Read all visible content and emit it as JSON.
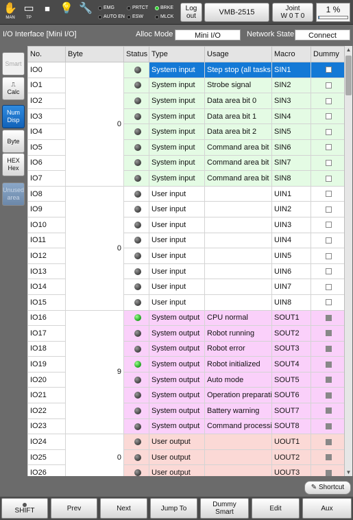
{
  "topbar": {
    "icons": [
      {
        "name": "man-icon",
        "label": "MAN",
        "glyph": "✋"
      },
      {
        "name": "tp-icon",
        "label": "TP",
        "glyph": "▭"
      },
      {
        "name": "stop-icon",
        "label": "",
        "glyph": "■"
      },
      {
        "name": "lightbulb-icon",
        "label": "",
        "glyph": "💡"
      },
      {
        "name": "wrench-icon",
        "label": "",
        "glyph": "🔧"
      }
    ],
    "lamps": {
      "emg": {
        "label": "EMG",
        "on": false
      },
      "auto_en": {
        "label": "AUTO EN",
        "on": false
      },
      "prtct": {
        "label": "PRTCT",
        "on": false
      },
      "esw": {
        "label": "ESW",
        "on": false
      },
      "brke": {
        "label": "BRKE",
        "on": true
      },
      "mlck": {
        "label": "MLCK",
        "on": false
      }
    },
    "logout": {
      "line1": "Log",
      "line2": "out"
    },
    "robot_label": "VMB-2515",
    "coord": {
      "line1": "Joint",
      "line2": "W 0 T 0"
    },
    "speed_text": "1 %",
    "speed_fraction": 0.01
  },
  "title": {
    "text": "I/O Interface [Mini I/O]",
    "alloc_label": "Alloc Mode",
    "alloc_value": "Mini I/O",
    "network_label": "Network State",
    "network_value": "Connect"
  },
  "side_buttons": [
    {
      "name": "smart-button",
      "l1": "Smart",
      "l2": "",
      "state": "disabled"
    },
    {
      "name": "calc-button",
      "l1": "⎍",
      "l2": "Calc",
      "state": "normal"
    },
    {
      "name": "num-disp-button",
      "l1": "Num",
      "l2": "Disp",
      "state": "active"
    },
    {
      "name": "byte-button",
      "l1": "Byte",
      "l2": "",
      "state": "normal"
    },
    {
      "name": "hex-button",
      "l1": "HEX",
      "l2": "Hex",
      "state": "normal"
    },
    {
      "name": "unused-area-button",
      "l1": "Unused",
      "l2": "area",
      "state": "dis2"
    }
  ],
  "table": {
    "headers": [
      "No.",
      "Byte",
      "Status",
      "Type",
      "Usage",
      "Macro",
      "Dummy"
    ],
    "byte_groups": [
      {
        "value": "0",
        "rows": 8
      },
      {
        "value": "0",
        "rows": 8
      },
      {
        "value": "9",
        "rows": 8
      },
      {
        "value": "0",
        "rows": 3
      }
    ],
    "rows": [
      {
        "no": "IO0",
        "on": false,
        "type": "System input",
        "usage": "Step stop (all tasks",
        "macro": "SIN1",
        "dummy": false,
        "color": "g",
        "selected": true
      },
      {
        "no": "IO1",
        "on": false,
        "type": "System input",
        "usage": "Strobe signal",
        "macro": "SIN2",
        "dummy": false,
        "color": "g"
      },
      {
        "no": "IO2",
        "on": false,
        "type": "System input",
        "usage": "Data area bit 0",
        "macro": "SIN3",
        "dummy": false,
        "color": "g"
      },
      {
        "no": "IO3",
        "on": false,
        "type": "System input",
        "usage": "Data area bit 1",
        "macro": "SIN4",
        "dummy": false,
        "color": "g"
      },
      {
        "no": "IO4",
        "on": false,
        "type": "System input",
        "usage": "Data area bit 2",
        "macro": "SIN5",
        "dummy": false,
        "color": "g"
      },
      {
        "no": "IO5",
        "on": false,
        "type": "System input",
        "usage": "Command area  bit",
        "macro": "SIN6",
        "dummy": false,
        "color": "g"
      },
      {
        "no": "IO6",
        "on": false,
        "type": "System input",
        "usage": "Command area  bit",
        "macro": "SIN7",
        "dummy": false,
        "color": "g"
      },
      {
        "no": "IO7",
        "on": false,
        "type": "System input",
        "usage": "Command area  bit",
        "macro": "SIN8",
        "dummy": false,
        "color": "g"
      },
      {
        "no": "IO8",
        "on": false,
        "type": "User input",
        "usage": "",
        "macro": "UIN1",
        "dummy": false,
        "color": "u"
      },
      {
        "no": "IO9",
        "on": false,
        "type": "User input",
        "usage": "",
        "macro": "UIN2",
        "dummy": false,
        "color": "u"
      },
      {
        "no": "IO10",
        "on": false,
        "type": "User input",
        "usage": "",
        "macro": "UIN3",
        "dummy": false,
        "color": "u"
      },
      {
        "no": "IO11",
        "on": false,
        "type": "User input",
        "usage": "",
        "macro": "UIN4",
        "dummy": false,
        "color": "u"
      },
      {
        "no": "IO12",
        "on": false,
        "type": "User input",
        "usage": "",
        "macro": "UIN5",
        "dummy": false,
        "color": "u"
      },
      {
        "no": "IO13",
        "on": false,
        "type": "User input",
        "usage": "",
        "macro": "UIN6",
        "dummy": false,
        "color": "u"
      },
      {
        "no": "IO14",
        "on": false,
        "type": "User input",
        "usage": "",
        "macro": "UIN7",
        "dummy": false,
        "color": "u"
      },
      {
        "no": "IO15",
        "on": false,
        "type": "User input",
        "usage": "",
        "macro": "UIN8",
        "dummy": false,
        "color": "u"
      },
      {
        "no": "IO16",
        "on": true,
        "type": "System output",
        "usage": "CPU normal",
        "macro": "SOUT1",
        "dummy": true,
        "color": "p"
      },
      {
        "no": "IO17",
        "on": false,
        "type": "System output",
        "usage": "Robot running",
        "macro": "SOUT2",
        "dummy": true,
        "color": "p"
      },
      {
        "no": "IO18",
        "on": false,
        "type": "System output",
        "usage": "Robot error",
        "macro": "SOUT3",
        "dummy": true,
        "color": "p"
      },
      {
        "no": "IO19",
        "on": true,
        "type": "System output",
        "usage": "Robot initialized",
        "macro": "SOUT4",
        "dummy": true,
        "color": "p"
      },
      {
        "no": "IO20",
        "on": false,
        "type": "System output",
        "usage": "Auto mode",
        "macro": "SOUT5",
        "dummy": true,
        "color": "p"
      },
      {
        "no": "IO21",
        "on": false,
        "type": "System output",
        "usage": "Operation preparatio",
        "macro": "SOUT6",
        "dummy": true,
        "color": "p"
      },
      {
        "no": "IO22",
        "on": false,
        "type": "System output",
        "usage": "Battery warning",
        "macro": "SOUT7",
        "dummy": true,
        "color": "p"
      },
      {
        "no": "IO23",
        "on": false,
        "type": "System output",
        "usage": "Command processi",
        "macro": "SOUT8",
        "dummy": true,
        "color": "p"
      },
      {
        "no": "IO24",
        "on": false,
        "type": "User output",
        "usage": "",
        "macro": "UOUT1",
        "dummy": true,
        "color": "r"
      },
      {
        "no": "IO25",
        "on": false,
        "type": "User output",
        "usage": "",
        "macro": "UOUT2",
        "dummy": true,
        "color": "r"
      },
      {
        "no": "IO26",
        "on": false,
        "type": "User output",
        "usage": "",
        "macro": "UOUT3",
        "dummy": true,
        "color": "r"
      }
    ]
  },
  "shortcut": {
    "label": "Shortcut",
    "icon": "edit-icon"
  },
  "bottom": [
    {
      "name": "shift-button",
      "label": "SHIFT"
    },
    {
      "name": "prev-button",
      "label": "Prev"
    },
    {
      "name": "next-button",
      "label": "Next"
    },
    {
      "name": "jump-to-button",
      "label": "Jump To"
    },
    {
      "name": "dummy-smart-button",
      "label": "Dummy\nSmart"
    },
    {
      "name": "edit-button",
      "label": "Edit"
    },
    {
      "name": "aux-button",
      "label": "Aux"
    }
  ]
}
